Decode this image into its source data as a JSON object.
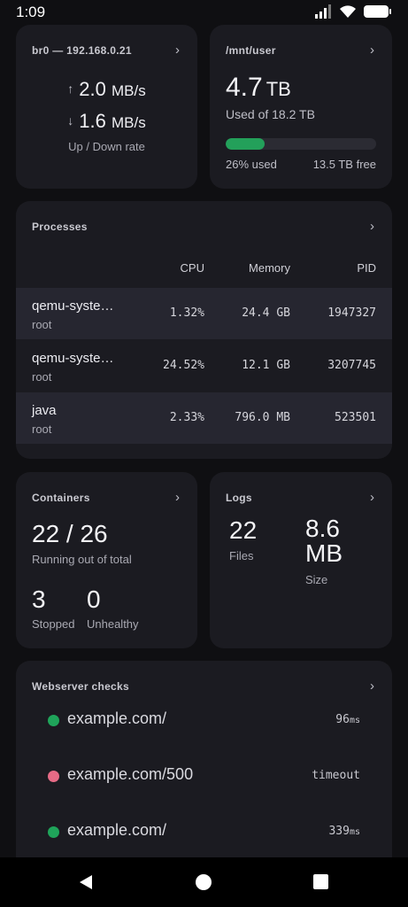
{
  "status_bar": {
    "time": "1:09"
  },
  "network": {
    "title": "br0 — 192.168.0.21",
    "up_value": "2.0",
    "up_unit": "MB/s",
    "down_value": "1.6",
    "down_unit": "MB/s",
    "caption": "Up / Down rate"
  },
  "storage": {
    "title": "/mnt/user",
    "used_value": "4.7",
    "used_unit": "TB",
    "used_of": "Used of 18.2 TB",
    "used_fraction": 0.26,
    "used_pct_label": "26% used",
    "free_label": "13.5 TB free"
  },
  "processes": {
    "title": "Processes",
    "columns": {
      "cpu": "CPU",
      "memory": "Memory",
      "pid": "PID"
    },
    "rows": [
      {
        "name": "qemu-syste…",
        "user": "root",
        "cpu": "1.32%",
        "memory": "24.4 GB",
        "pid": "1947327"
      },
      {
        "name": "qemu-syste…",
        "user": "root",
        "cpu": "24.52%",
        "memory": "12.1 GB",
        "pid": "3207745"
      },
      {
        "name": "java",
        "user": "root",
        "cpu": "2.33%",
        "memory": "796.0 MB",
        "pid": "523501"
      }
    ]
  },
  "containers": {
    "title": "Containers",
    "running": "22 / 26",
    "running_label": "Running out of total",
    "stopped": "3",
    "stopped_label": "Stopped",
    "unhealthy": "0",
    "unhealthy_label": "Unhealthy"
  },
  "logs": {
    "title": "Logs",
    "files": "22",
    "files_label": "Files",
    "size_value": "8.6",
    "size_unit": "MB",
    "size_label": "Size"
  },
  "webserver": {
    "title": "Webserver checks",
    "checks": [
      {
        "url": "example.com/",
        "time": "96",
        "unit": "ms",
        "status_color": "#1fa45a"
      },
      {
        "url": "example.com/500",
        "time": "timeout",
        "unit": "",
        "status_color": "#e66b86"
      },
      {
        "url": "example.com/",
        "time": "339",
        "unit": "ms",
        "status_color": "#1fa45a"
      }
    ]
  },
  "colors": {
    "ok": "#1fa45a",
    "error": "#e66b86",
    "progress": "#23a05a",
    "card": "#1b1b21"
  },
  "icons": [
    "signal-icon",
    "wifi-icon",
    "battery-icon",
    "chevron-right-icon",
    "arrow-up-icon",
    "arrow-down-icon",
    "back-icon",
    "home-icon",
    "recents-icon"
  ]
}
